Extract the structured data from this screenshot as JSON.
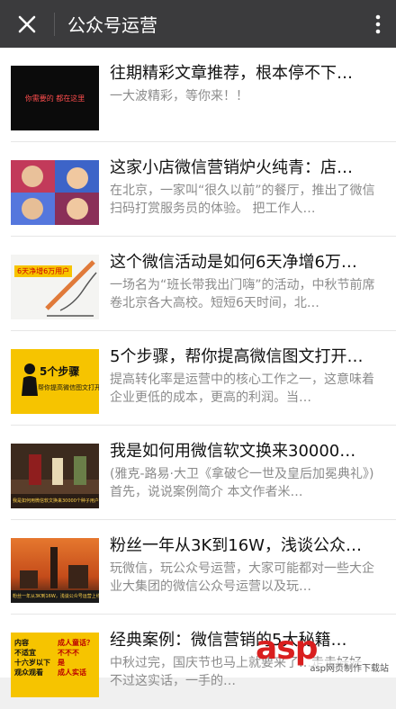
{
  "header": {
    "title": "公众号运营",
    "close_icon": "close-icon",
    "more_icon": "more-vertical-icon"
  },
  "articles": [
    {
      "title": "往期精彩文章推荐，根本停不下…",
      "desc": "一大波精彩，等你来！！",
      "thumb_text": "你需要的 都在这里"
    },
    {
      "title": "这家小店微信营销炉火纯青：店…",
      "desc": "在北京，一家叫“很久以前”的餐厅，推出了微信扫码打赏服务员的体验。 把工作人…"
    },
    {
      "title": "这个微信活动是如何6天净增6万…",
      "desc": "一场名为“班长带我出门嗨”的活动，中秋节前席卷北京各大高校。短短6天时间，北…",
      "thumb_text": "6天净增6万用户"
    },
    {
      "title": "5个步骤，帮你提高微信图文打开…",
      "desc": "提高转化率是运营中的核心工作之一，这意味着企业更低的成本，更高的利润。当…",
      "thumb_text_1": "5个步骤",
      "thumb_text_2": "帮你提高微信图文打开率"
    },
    {
      "title": "我是如何用微信软文换来30000…",
      "desc": "(雅克-路易·大卫《拿破仑一世及皇后加冕典礼》)首先，说说案例简介 本文作者米…",
      "thumb_text": "我是如何用微信软文换来30000个种子用户的？"
    },
    {
      "title": "粉丝一年从3K到16W，浅谈公众…",
      "desc": "玩微信，玩公众号运营，大家可能都对一些大企业大集团的微信公众号运营以及玩…",
      "thumb_text": "粉丝一年从3K到16W，浅谈公众号运营上线下推广"
    },
    {
      "title": "经典案例：微信营销的5大秘籍…",
      "desc": "中秋过完，国庆节也马上就要来了…走走好好，不过这实话，一手的…",
      "thumb_lines": [
        "内容",
        "不适宜",
        "十六岁以下",
        "观众观看"
      ],
      "thumb_lines_2": [
        "成人童话？",
        "不不不",
        "是",
        "成人实话"
      ]
    }
  ],
  "watermark": {
    "main": "asp",
    "sub": "asp网页制作下载站"
  }
}
